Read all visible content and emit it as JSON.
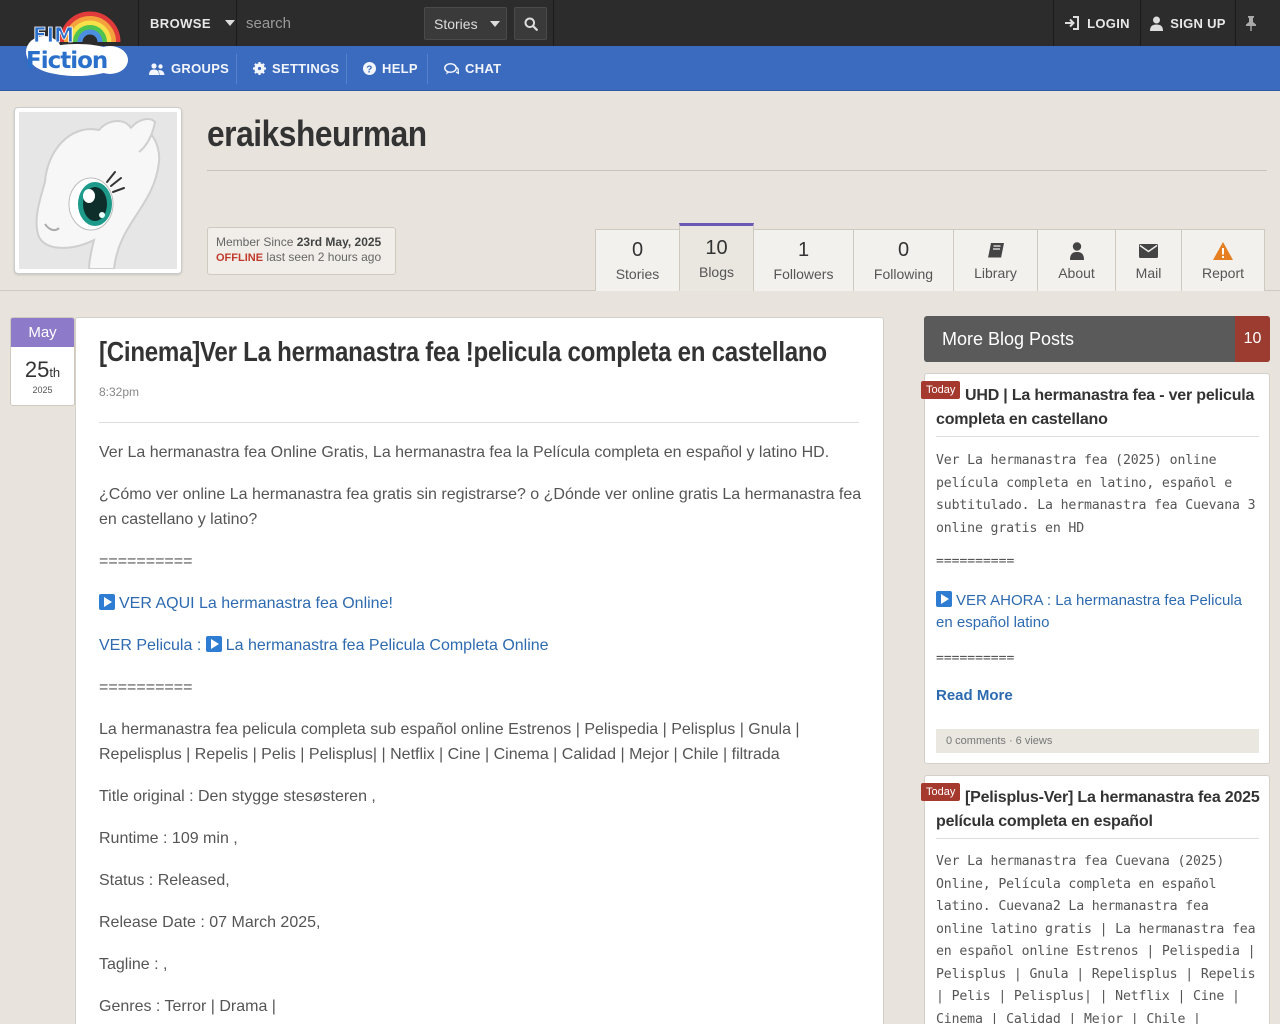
{
  "topbar": {
    "logo_top": "FIM",
    "logo_bottom": "Fiction",
    "browse_label": "BROWSE",
    "search_placeholder": "search",
    "search_scope": "Stories",
    "login_label": "LOGIN",
    "signup_label": "SIGN UP"
  },
  "nav": {
    "items": [
      {
        "label": "GROUPS",
        "icon": "users-icon"
      },
      {
        "label": "SETTINGS",
        "icon": "gear-icon"
      },
      {
        "label": "HELP",
        "icon": "question-icon"
      },
      {
        "label": "CHAT",
        "icon": "chat-icon"
      }
    ]
  },
  "profile": {
    "username": "eraiksheurman",
    "member_since_label": "Member Since",
    "member_since_date": "23rd May, 2025",
    "status": "OFFLINE",
    "last_seen": "last seen 2 hours ago",
    "tabs": [
      {
        "value": "0",
        "label": "Stories"
      },
      {
        "value": "10",
        "label": "Blogs"
      },
      {
        "value": "1",
        "label": "Followers"
      },
      {
        "value": "0",
        "label": "Following"
      },
      {
        "value": "",
        "label": "Library",
        "icon": "book-icon"
      },
      {
        "value": "",
        "label": "About",
        "icon": "user-icon"
      },
      {
        "value": "",
        "label": "Mail",
        "icon": "mail-icon"
      },
      {
        "value": "",
        "label": "Report",
        "icon": "warning-icon"
      }
    ]
  },
  "post": {
    "month": "May",
    "day": "25",
    "day_suffix": "th",
    "year": "2025",
    "title": "[Cinema]Ver La hermanastra fea !pelicula completa en castellano",
    "time": "8:32pm",
    "paragraphs": {
      "p1": "Ver La hermanastra fea Online Gratis, La hermanastra fea la Película completa en español y latino HD.",
      "p2": "¿Cómo ver online La hermanastra fea gratis sin registrarse? o ¿Dónde ver online gratis La hermanastra fea en castellano y latino?",
      "sep1": "==========",
      "link1": "VER AQUI La hermanastra fea Online!",
      "link2_prefix": "VER Pelicula :",
      "link2": "La hermanastra fea Pelicula Completa Online",
      "sep2": "==========",
      "p3": "La hermanastra fea pelicula completa sub español online Estrenos | Pelispedia | Pelisplus | Gnula | Repelisplus | Repelis | Pelis | Pelisplus| | Netflix | Cine | Cinema | Calidad | Mejor | Chile | filtrada",
      "p4": "Title original : Den stygge stesøsteren ,",
      "p5": "Runtime : 109 min ,",
      "p6": "Status : Released,",
      "p7": "Release Date : 07 March 2025,",
      "p8": "Tagline : ,",
      "p9": "Genres : Terror | Drama |"
    }
  },
  "sidebar": {
    "header": "More Blog Posts",
    "count": "10",
    "cards": [
      {
        "badge": "Today",
        "title": "UHD | La hermanastra fea - ver pelicula completa en castellano",
        "excerpt": "Ver La hermanastra fea (2025) online película completa en latino, español e subtitulado. La hermanastra fea Cuevana 3 online gratis en HD",
        "sep": "==========",
        "link": "VER AHORA : La hermanastra fea Pelicula en español latino",
        "sep2": "==========",
        "read_more": "Read More",
        "footer": "0 comments · 6 views"
      },
      {
        "badge": "Today",
        "title": "[Pelisplus-Ver] La hermanastra fea 2025 película completa en español",
        "excerpt": "Ver La hermanastra fea Cuevana (2025) Online, Película completa en español latino. Cuevana2 La hermanastra fea online latino gratis | La hermanastra fea en español online Estrenos | Pelispedia | Pelisplus | Gnula | Repelisplus | Repelis | Pelis | Pelisplus| | Netflix | Cine | Cinema | Calidad | Mejor | Chile | filtrada"
      }
    ]
  },
  "colors": {
    "topbar": "#2c2c2c",
    "navbar": "#3b6bbf",
    "accent_purple": "#8d7ac9",
    "badge_red": "#a6392e",
    "link_blue": "#2e6ab0"
  }
}
